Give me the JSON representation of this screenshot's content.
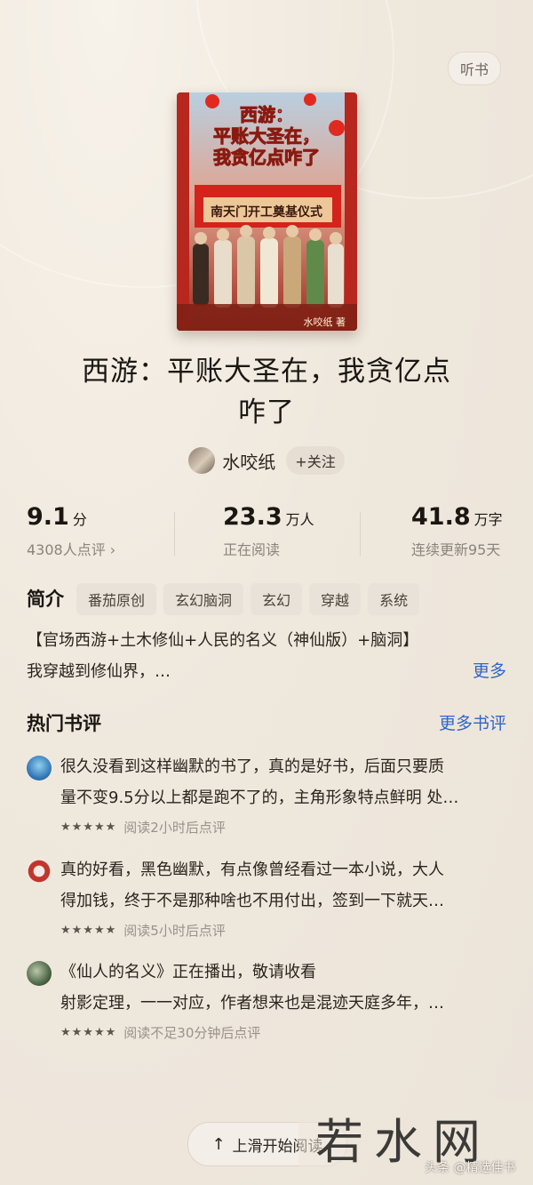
{
  "header": {
    "listen_label": "听书"
  },
  "book": {
    "cover_title": "西游：平账大圣在，我贪亿点咋了",
    "cover_title_line1": "西游：",
    "cover_title_line2": "平账大圣在，",
    "cover_title_line3": "我贪亿点咋了",
    "cover_subtitle": "南天门开工奠基仪式",
    "cover_author": "水咬纸 著",
    "title_line1": "西游：平账大圣在，我贪亿点",
    "title_line2": "咋了"
  },
  "author": {
    "name": "水咬纸",
    "follow_label": "+关注"
  },
  "stats": {
    "rating": {
      "value": "9.1",
      "unit": "分",
      "sub": "4308人点评 ›"
    },
    "readers": {
      "value": "23.3",
      "unit": "万人",
      "sub": "正在阅读"
    },
    "words": {
      "value": "41.8",
      "unit": "万字",
      "sub": "连续更新95天"
    }
  },
  "intro": {
    "heading": "简介",
    "tags": [
      "番茄原创",
      "玄幻脑洞",
      "玄幻",
      "穿越",
      "系统"
    ],
    "line1": "【官场西游+土木修仙+人民的名义（神仙版）+脑洞】",
    "line2": "我穿越到修仙界，…",
    "more_label": "更多"
  },
  "reviews": {
    "heading": "热门书评",
    "more_label": "更多书评",
    "items": [
      {
        "line1": "很久没看到这样幽默的书了，真的是好书，后面只要质",
        "line2": "量不变9.5分以上都是跑不了的，主角形象特点鲜明 处…",
        "stars": "★★★★★",
        "meta": "阅读2小时后点评",
        "stars_value": 5
      },
      {
        "line1": "真的好看，黑色幽默，有点像曾经看过一本小说，大人",
        "line2": "得加钱，终于不是那种啥也不用付出，签到一下就天…",
        "stars": "★★★★★",
        "meta": "阅读5小时后点评",
        "stars_value": 5
      },
      {
        "line1": "《仙人的名义》正在播出，敬请收看",
        "line2": "射影定理，一一对应，作者想来也是混迹天庭多年，…",
        "stars": "★★★★★",
        "meta": "阅读不足30分钟后点评",
        "stars_value": 5
      }
    ]
  },
  "footer": {
    "read_button_label": "上滑开始阅读"
  },
  "watermark": {
    "text": "若水网",
    "small": "头条 @精选佳书"
  },
  "colors": {
    "link": "#2f66c9",
    "background": "#efe8dd",
    "cover_red": "#c8231b"
  }
}
